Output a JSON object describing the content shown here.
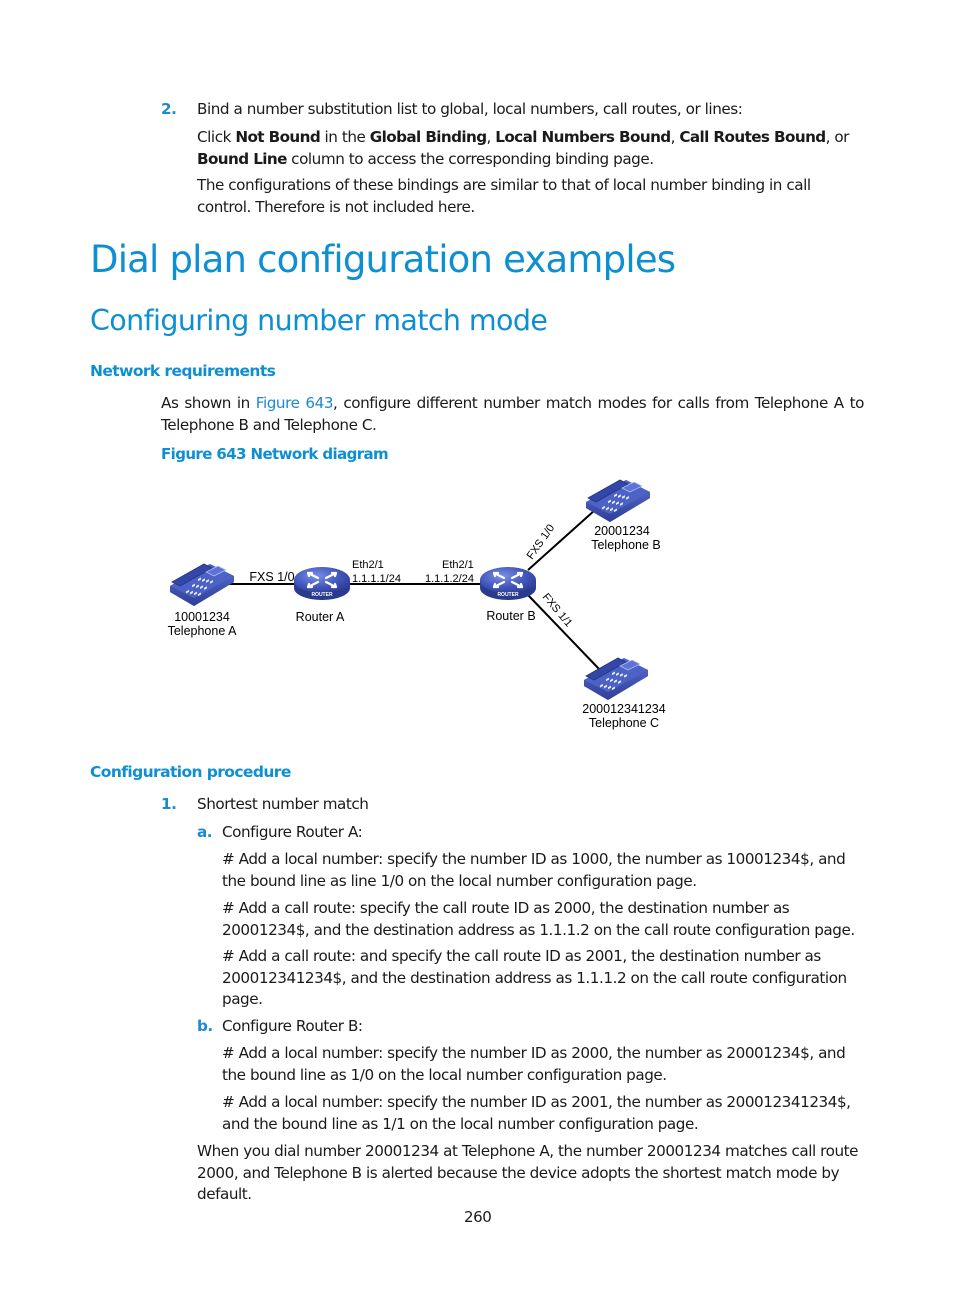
{
  "step2": {
    "number": "2.",
    "title": "Bind a number substitution list to global, local numbers, call routes, or lines:",
    "click_prefix": "Click ",
    "not_bound": "Not Bound",
    "in_the": " in the ",
    "global_binding": "Global Binding",
    "comma1": ", ",
    "local_numbers_bound": "Local Numbers Bound",
    "comma2": ", ",
    "call_routes_bound": "Call Routes Bound",
    "or": ", or ",
    "bound_line": "Bound Line",
    "click_suffix": " column to access the corresponding binding page.",
    "note": "The configurations of these bindings are similar to that of local number binding in call control. Therefore is not included here."
  },
  "headings": {
    "h1": "Dial plan configuration examples",
    "h2": "Configuring number match mode",
    "network_requirements": "Network requirements",
    "configuration_procedure": "Configuration procedure"
  },
  "network_requirements": {
    "text_before": "As shown in ",
    "figure_link": "Figure 643",
    "text_after": ", configure different number match modes for calls from Telephone A to Telephone B and Telephone C."
  },
  "figure": {
    "caption": "Figure 643 Network diagram",
    "telephone_a": {
      "number": "10001234",
      "name": "Telephone A"
    },
    "telephone_b": {
      "number": "20001234",
      "name": "Telephone B"
    },
    "telephone_c": {
      "number": "200012341234",
      "name": "Telephone C"
    },
    "router_a": {
      "name": "Router A",
      "badge": "ROUTER"
    },
    "router_b": {
      "name": "Router B",
      "badge": "ROUTER"
    },
    "link_a_fxs": "FXS 1/0",
    "router_a_eth": "Eth2/1",
    "router_a_ip": "1.1.1.1/24",
    "router_b_eth": "Eth2/1",
    "router_b_ip": "1.1.1.2/24",
    "link_b_fxs10": "FXS 1/0",
    "link_b_fxs11": "FXS 1/1",
    "colors": {
      "device": "#3b4fb0",
      "device_dark": "#26357e",
      "device_light": "#6d7fd8"
    }
  },
  "procedure": {
    "step1": {
      "number": "1.",
      "title": "Shortest number match"
    },
    "a": {
      "letter": "a.",
      "title": "Configure Router A:",
      "p1": "# Add a local number: specify the number ID as 1000, the number as 10001234$, and the bound line as line 1/0 on the local number configuration page.",
      "p2": "# Add a call route: specify the call route ID as 2000, the destination number as 20001234$, and the destination address as 1.1.1.2 on the call route configuration page.",
      "p3": "# Add a call route: and specify the call route ID as 2001, the destination number as 200012341234$, and the destination address as 1.1.1.2 on the call route configuration page."
    },
    "b": {
      "letter": "b.",
      "title": "Configure Router B:",
      "p1": "# Add a local number: specify the number ID as 2000, the number as 20001234$, and the bound line as 1/0 on the local number configuration page.",
      "p2": "# Add a local number: specify the number ID as 2001, the number as 200012341234$, and the bound line as 1/1 on the local number configuration page."
    },
    "result": "When you dial number 20001234 at Telephone A, the number 20001234 matches call route 2000, and Telephone B is alerted because the device adopts the shortest match mode by default."
  },
  "page_number": "260"
}
